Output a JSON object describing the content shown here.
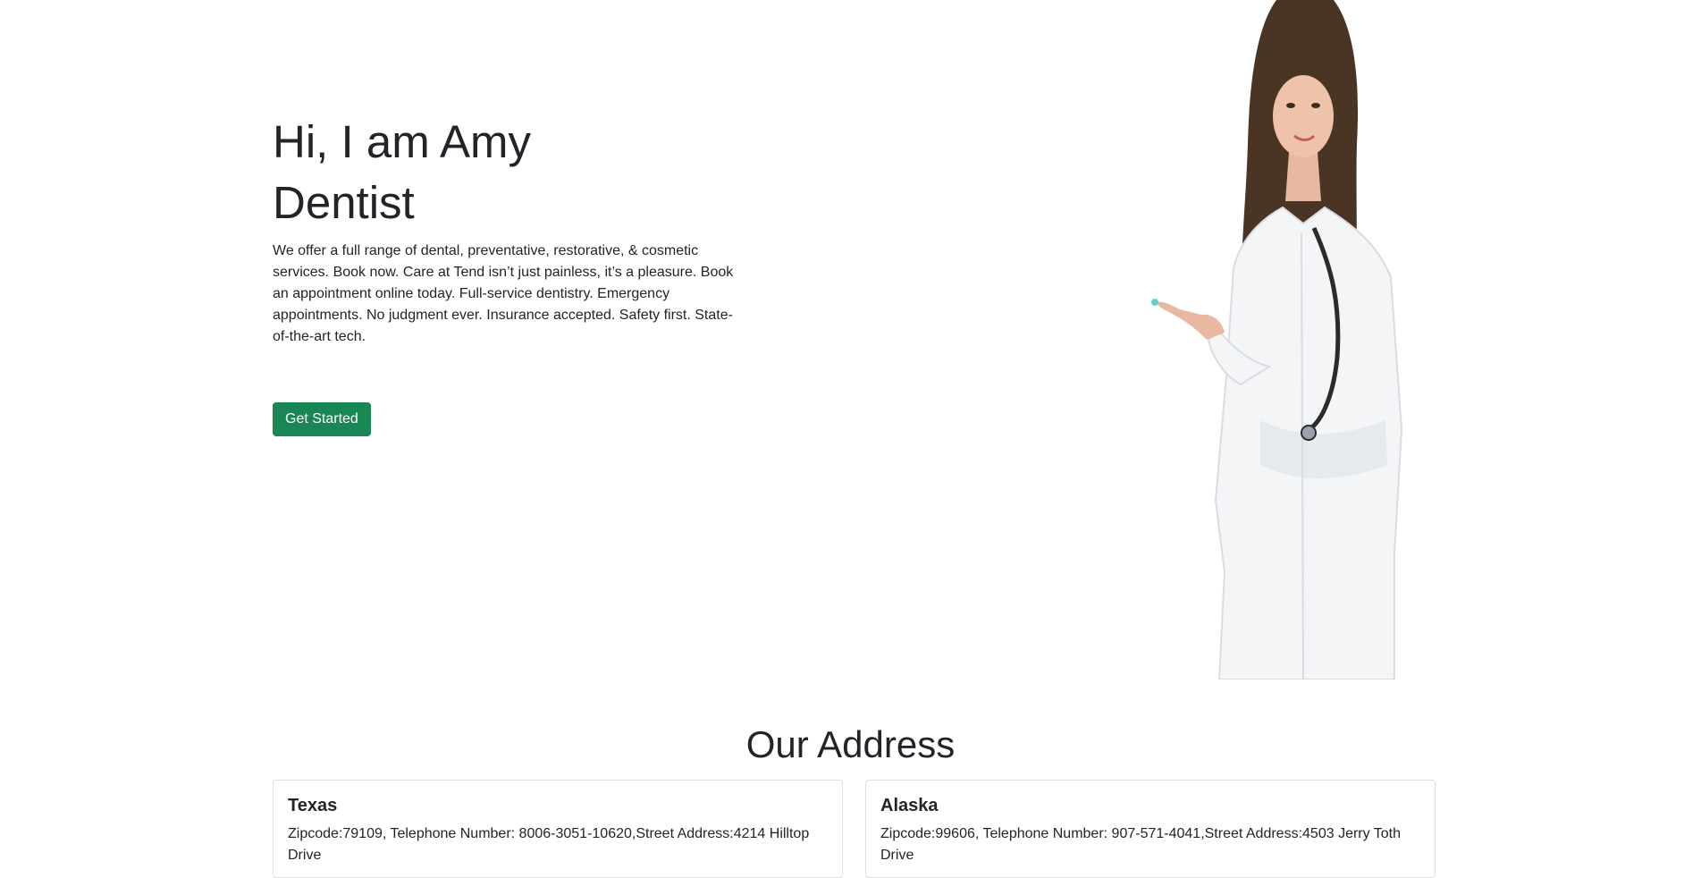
{
  "hero": {
    "title_line1": "Hi, I am Amy",
    "title_line2": "Dentist",
    "description": "We offer a full range of dental, preventative, restorative, & cosmetic services. Book now. Care at Tend isn’t just painless, it’s a pleasure. Book an appointment online today. Full-service dentistry. Emergency appointments. No judgment ever. Insurance accepted. Safety first. State-of-the-art tech.",
    "cta_label": "Get Started",
    "cta_color": "#198754",
    "image_icon": "dentist-portrait"
  },
  "address_section": {
    "title": "Our Address",
    "cards": [
      {
        "state": "Texas",
        "details": "Zipcode:79109, Telephone Number: 8006-3051-10620,Street Address:4214 Hilltop Drive"
      },
      {
        "state": "Alaska",
        "details": "Zipcode:99606, Telephone Number: 907-571-4041,Street Address:4503 Jerry Toth Drive"
      }
    ]
  }
}
